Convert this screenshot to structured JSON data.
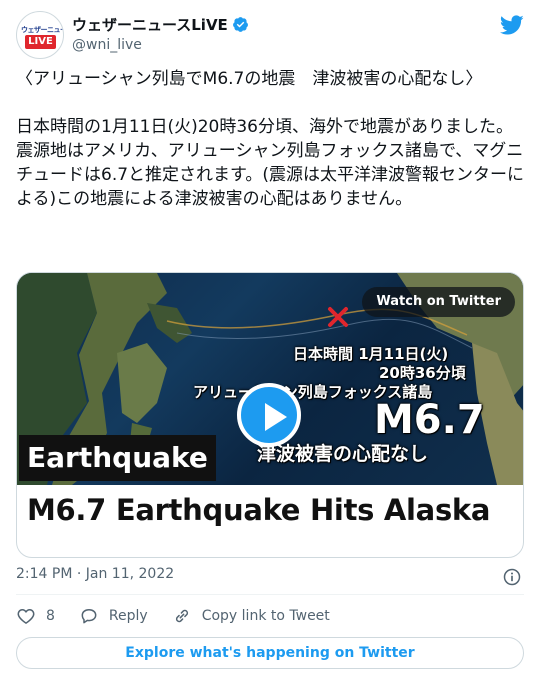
{
  "account": {
    "display_name": "ウェザーニュースLiVE",
    "handle": "@wni_live",
    "avatar_top_text": "ウェザーニュース",
    "avatar_badge_text": "LIVE"
  },
  "tweet": {
    "text": "〈アリューシャン列島でM6.7の地震　津波被害の心配なし〉\n\n日本時間の1月11日(火)20時36分頃、海外で地震がありました。震源地はアメリカ、アリューシャン列島フォックス諸島で、マグニチュードは6.7と推定されます。(震源は太平洋津波警報センターによる)この地震による津波被害の心配はありません。"
  },
  "card": {
    "watch_label": "Watch on Twitter",
    "overlay_time_line1": "日本時間 1月11日(火)",
    "overlay_time_line2": "20時36分頃",
    "overlay_region": "アリューシャン列島フォックス諸島",
    "overlay_magnitude": "M6.7",
    "overlay_tsunami": "津波被害の心配なし",
    "label": "Earthquake",
    "title": "M6.7 Earthquake Hits Alaska"
  },
  "meta": {
    "timestamp": "2:14 PM · Jan 11, 2022"
  },
  "actions": {
    "like_count": "8",
    "reply_label": "Reply",
    "copy_link_label": "Copy link to Tweet"
  },
  "footer": {
    "explore_label": "Explore what's happening on Twitter"
  },
  "colors": {
    "accent": "#1d9bf0",
    "text": "#0f1419",
    "secondary": "#536471",
    "border": "#cfd9de",
    "quake_marker": "#e0262d"
  },
  "icons": [
    "avatar",
    "verified-badge-icon",
    "twitter-bird-icon",
    "play-icon",
    "quake-x-marker-icon",
    "info-icon",
    "heart-icon",
    "reply-icon",
    "link-icon"
  ]
}
